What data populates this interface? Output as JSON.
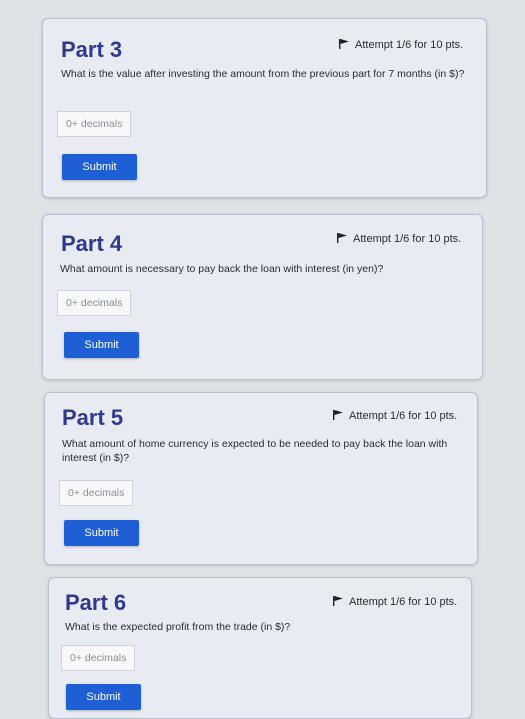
{
  "parts": [
    {
      "title": "Part 3",
      "attempt": "Attempt 1/6 for 10 pts.",
      "question": "What is the value after investing the amount from the previous part for 7 months (in $)?",
      "placeholder": "0+ decimals",
      "submit": "Submit"
    },
    {
      "title": "Part 4",
      "attempt": "Attempt 1/6 for 10 pts.",
      "question": "What amount is necessary to pay back the loan with interest (in yen)?",
      "placeholder": "0+ decimals",
      "submit": "Submit"
    },
    {
      "title": "Part 5",
      "attempt": "Attempt 1/6 for 10 pts.",
      "question": "What amount of home currency is expected to be needed to pay back the loan with interest (in $)?",
      "placeholder": "0+ decimals",
      "submit": "Submit"
    },
    {
      "title": "Part 6",
      "attempt": "Attempt 1/6 for 10 pts.",
      "question": "What is the expected profit from the trade (in $)?",
      "placeholder": "0+ decimals",
      "submit": "Submit"
    }
  ],
  "icons": {
    "attempt": "flag-icon"
  },
  "colors": {
    "title": "#2f3a8f",
    "submit": "#1f5fd6",
    "card": "#e9ebf3"
  }
}
